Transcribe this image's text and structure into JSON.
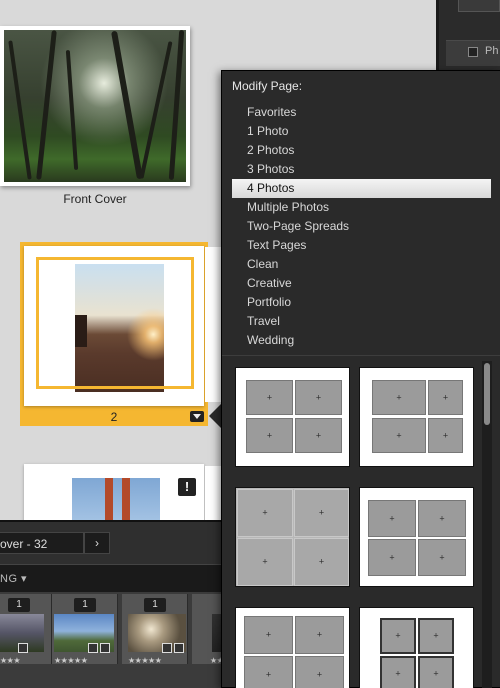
{
  "book": {
    "front_cover_label": "Front Cover",
    "page2_number": "2",
    "warning_badge": "!"
  },
  "right_panel": {
    "partial_label": "Ph"
  },
  "toolbar": {
    "cover_select_value": "over - 32",
    "next_button": "›"
  },
  "filmstrip": {
    "sort_label": "NG ▾",
    "cells": [
      {
        "badge": "1",
        "stars": "★★★"
      },
      {
        "badge": "1",
        "stars": "★★★★★"
      },
      {
        "badge": "1",
        "stars": "★★★★★"
      },
      {
        "badge": "",
        "stars": "★★"
      }
    ]
  },
  "popup": {
    "title": "Modify Page:",
    "items": [
      "Favorites",
      "1 Photo",
      "2 Photos",
      "3 Photos",
      "4 Photos",
      "Multiple Photos",
      "Two-Page Spreads",
      "Text Pages",
      "Clean",
      "Creative",
      "Portfolio",
      "Travel",
      "Wedding"
    ],
    "selected_item": "4 Photos"
  },
  "colors": {
    "selection_accent": "#f5b731",
    "popup_bg": "#2a2a2a",
    "canvas_bg": "#d9d9d9"
  }
}
